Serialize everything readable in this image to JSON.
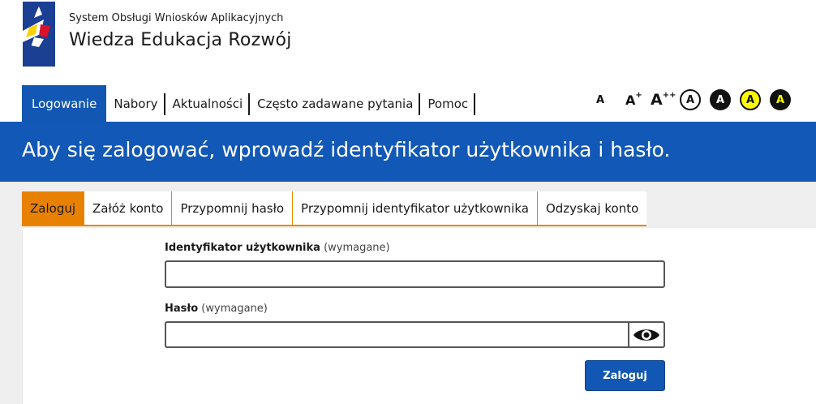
{
  "header": {
    "subtitle": "System Obsługi Wniosków Aplikacyjnych",
    "title": "Wiedza Edukacja Rozwój"
  },
  "nav": {
    "items": [
      {
        "label": "Logowanie",
        "active": true
      },
      {
        "label": "Nabory"
      },
      {
        "label": "Aktualności"
      },
      {
        "label": "Często zadawane pytania"
      },
      {
        "label": "Pomoc"
      }
    ]
  },
  "accessibility": {
    "font_small": "A",
    "font_medium": "A",
    "font_medium_sup": "+",
    "font_large": "A",
    "font_large_sup": "++",
    "contrast": [
      {
        "label": "A",
        "bg": "#ffffff",
        "fg": "#111111"
      },
      {
        "label": "A",
        "bg": "#111111",
        "fg": "#ffffff"
      },
      {
        "label": "A",
        "bg": "#ffff00",
        "fg": "#111111"
      },
      {
        "label": "A",
        "bg": "#111111",
        "fg": "#ffff00"
      }
    ]
  },
  "banner": {
    "text": "Aby się zalogować, wprowadź identyfikator użytkownika i hasło."
  },
  "tabs": [
    {
      "label": "Zaloguj",
      "active": true
    },
    {
      "label": "Załóż konto"
    },
    {
      "label": "Przypomnij hasło"
    },
    {
      "label": "Przypomnij identyfikator użytkownika"
    },
    {
      "label": "Odzyskaj konto"
    }
  ],
  "form": {
    "username_label": "Identyfikator użytkownika",
    "username_required": "(wymagane)",
    "username_value": "",
    "password_label": "Hasło",
    "password_required": "(wymagane)",
    "password_value": "",
    "submit_label": "Zaloguj"
  },
  "colors": {
    "primary_blue": "#1357b4",
    "accent_orange": "#e98100"
  }
}
